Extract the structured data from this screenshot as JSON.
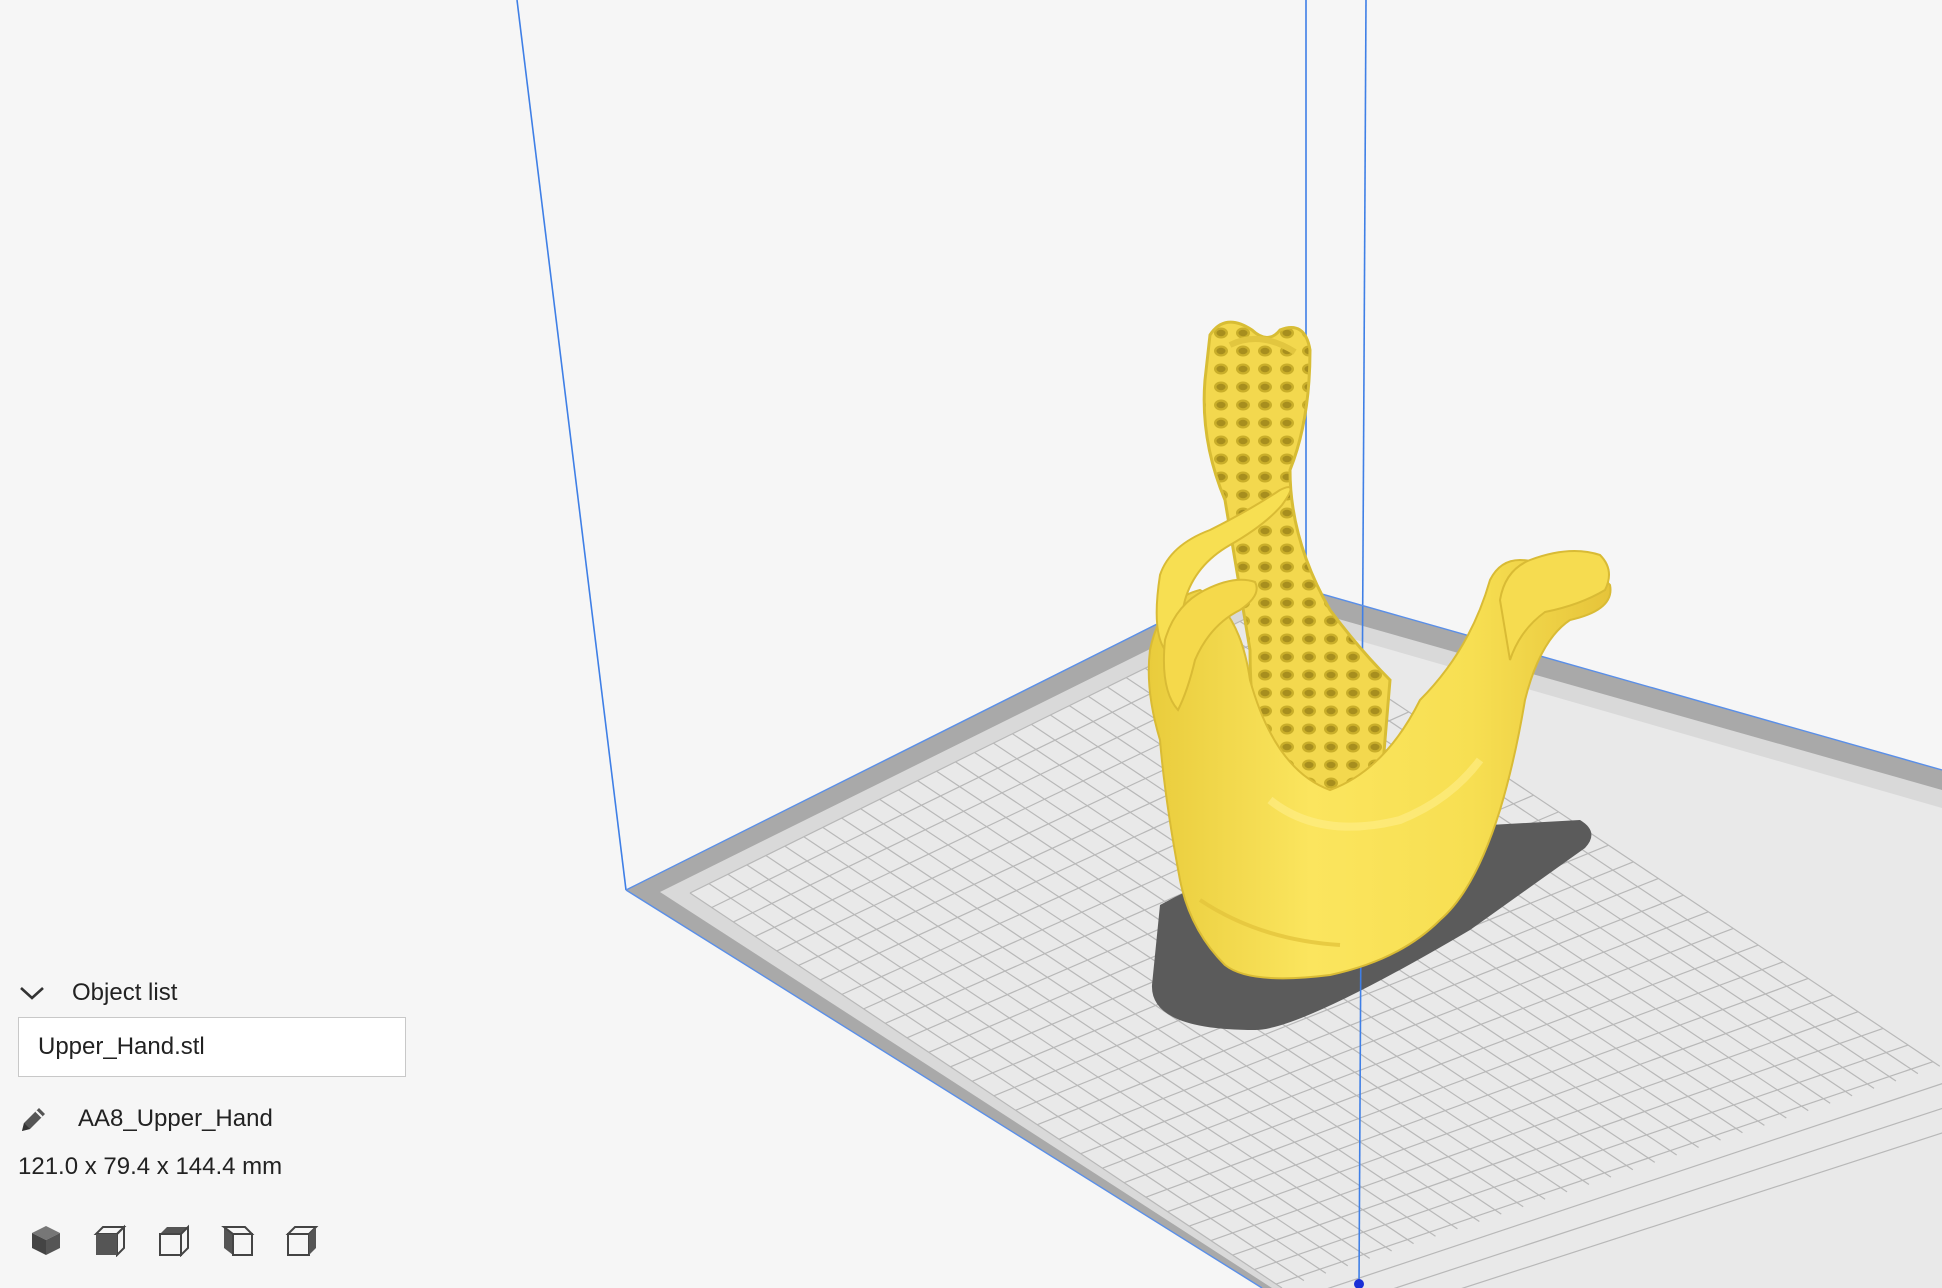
{
  "object_list": {
    "header_label": "Object list",
    "items": [
      "Upper_Hand.stl"
    ]
  },
  "selected_object": {
    "name": "AA8_Upper_Hand",
    "dimensions": "121.0 x 79.4 x 144.4 mm"
  },
  "view_buttons": [
    "view-3d-icon",
    "view-front-icon",
    "view-top-icon",
    "view-left-icon",
    "view-right-icon"
  ],
  "colors": {
    "model": "#fbe55e",
    "build_volume_line": "#3f7fe6",
    "plate": "#e6e6e6",
    "plate_border": "#a9a9a9",
    "background": "#f6f6f6"
  }
}
